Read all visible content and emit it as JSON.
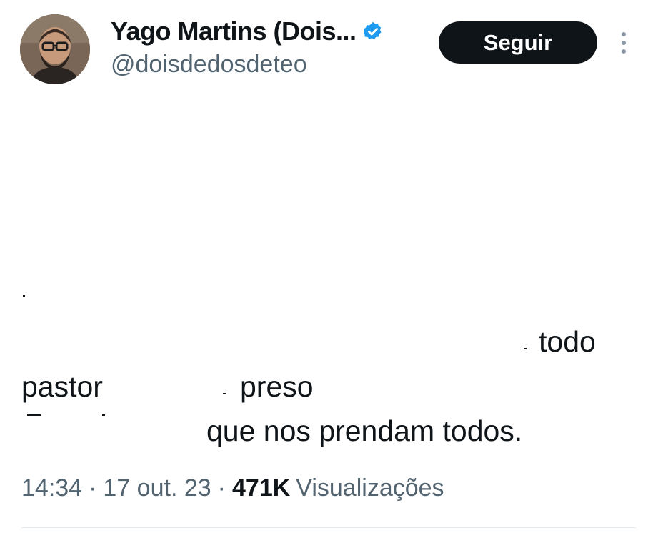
{
  "author": {
    "display_name": "Yago Martins (Dois...",
    "handle": "@doisdedosdeteo",
    "verified_icon": "verified-badge-icon",
    "avatar_icon": "avatar-photo"
  },
  "actions": {
    "follow_label": "Seguir",
    "more_icon": "more-vertical-icon"
  },
  "tweet": {
    "word_todo": "todo",
    "word_pastor": "pastor",
    "word_preso": "preso",
    "line_end": "que nos prendam todos."
  },
  "meta": {
    "time": "14:34",
    "separator": "·",
    "date": "17 out. 23",
    "views_count": "471K",
    "views_label": "Visualizações"
  },
  "colors": {
    "text": "#0f1419",
    "secondary": "#536471",
    "verified": "#1d9bf0",
    "button_bg": "#0f1419"
  }
}
